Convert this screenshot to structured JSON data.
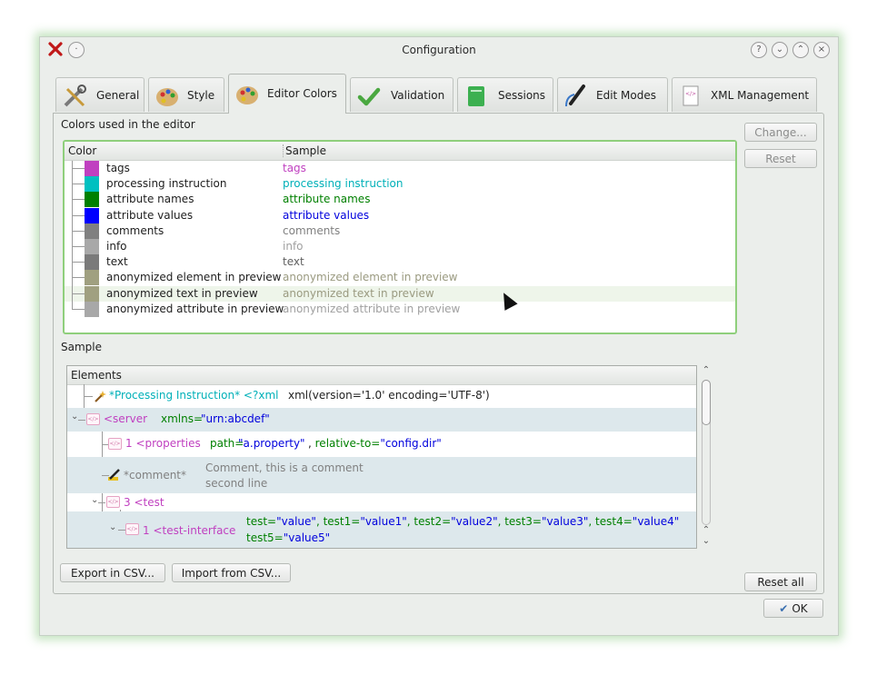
{
  "window": {
    "title": "Configuration"
  },
  "tabs": [
    {
      "label": "General",
      "icon": "tools-icon"
    },
    {
      "label": "Style",
      "icon": "palette-icon"
    },
    {
      "label": "Editor Colors",
      "icon": "palette-icon"
    },
    {
      "label": "Validation",
      "icon": "checkmark-icon"
    },
    {
      "label": "Sessions",
      "icon": "sessions-icon"
    },
    {
      "label": "Edit Modes",
      "icon": "pen-icon"
    },
    {
      "label": "XML Management",
      "icon": "xml-doc-icon"
    }
  ],
  "colors_group": {
    "label": "Colors used in the editor",
    "header_color": "Color",
    "header_sample": "Sample",
    "rows": [
      {
        "name": "tags",
        "sample": "tags",
        "swatch": "#c040c0",
        "text_color": "#c040c0"
      },
      {
        "name": "processing instruction",
        "sample": "processing instruction",
        "swatch": "#00c0c0",
        "text_color": "#00b0b8"
      },
      {
        "name": "attribute names",
        "sample": "attribute names",
        "swatch": "#008000",
        "text_color": "#008000"
      },
      {
        "name": "attribute values",
        "sample": "attribute values",
        "swatch": "#0000ff",
        "text_color": "#0000dd"
      },
      {
        "name": "comments",
        "sample": "comments",
        "swatch": "#808080",
        "text_color": "#808080"
      },
      {
        "name": "info",
        "sample": "info",
        "swatch": "#a8a8a8",
        "text_color": "#a0a0a0"
      },
      {
        "name": "text",
        "sample": "text",
        "swatch": "#7a7a7a",
        "text_color": "#606060"
      },
      {
        "name": "anonymized element in preview",
        "sample": "anonymized element in preview",
        "swatch": "#a0a080",
        "text_color": "#9a9a80"
      },
      {
        "name": "anonymized text in preview",
        "sample": "anonymized text in preview",
        "swatch": "#a0a080",
        "text_color": "#9a9a80"
      },
      {
        "name": "anonymized attribute in preview",
        "sample": "anonymized attribute in preview",
        "swatch": "#a8a8a8",
        "text_color": "#a0a0a0"
      }
    ]
  },
  "buttons": {
    "change": "Change...",
    "reset": "Reset",
    "reset_all": "Reset all",
    "export_csv": "Export in CSV...",
    "import_csv": "Import from CSV...",
    "ok": "OK"
  },
  "sample_group": {
    "label": "Sample",
    "header": "Elements",
    "pi_label": "*Processing Instruction* <?xml",
    "pi_value": "xml(version='1.0' encoding='UTF-8')",
    "server_tag": "<server",
    "server_attr_name": "xmlns=",
    "server_attr_value": "\"urn:abcdef\"",
    "properties_tag": "1 <properties",
    "prop_a1_name": "path=",
    "prop_a1_value": "\"a.property\"",
    "prop_sep": ", ",
    "prop_a2_name": "relative-to=",
    "prop_a2_value": "\"config.dir\"",
    "comment_label": "*comment*",
    "comment_line1": "Comment, this is a comment",
    "comment_line2": "second line",
    "test_tag": "3 <test",
    "ti_tag": "1 <test-interface",
    "ti_attrs": [
      {
        "name": "test=",
        "value": "\"value\""
      },
      {
        "name": ", test1=",
        "value": "\"value1\""
      },
      {
        "name": ", test2=",
        "value": "\"value2\""
      },
      {
        "name": ", test3=",
        "value": "\"value3\""
      },
      {
        "name": ", test4=",
        "value": "\"value4\""
      }
    ],
    "ti_line2_name": "test5=",
    "ti_line2_value": "\"value5\""
  },
  "colors": {
    "tag": "#c040c0",
    "pi": "#00b0b8",
    "attr_name": "#008000",
    "attr_value": "#0000dd",
    "comment": "#808080",
    "focus_border": "#8fcf7c"
  }
}
